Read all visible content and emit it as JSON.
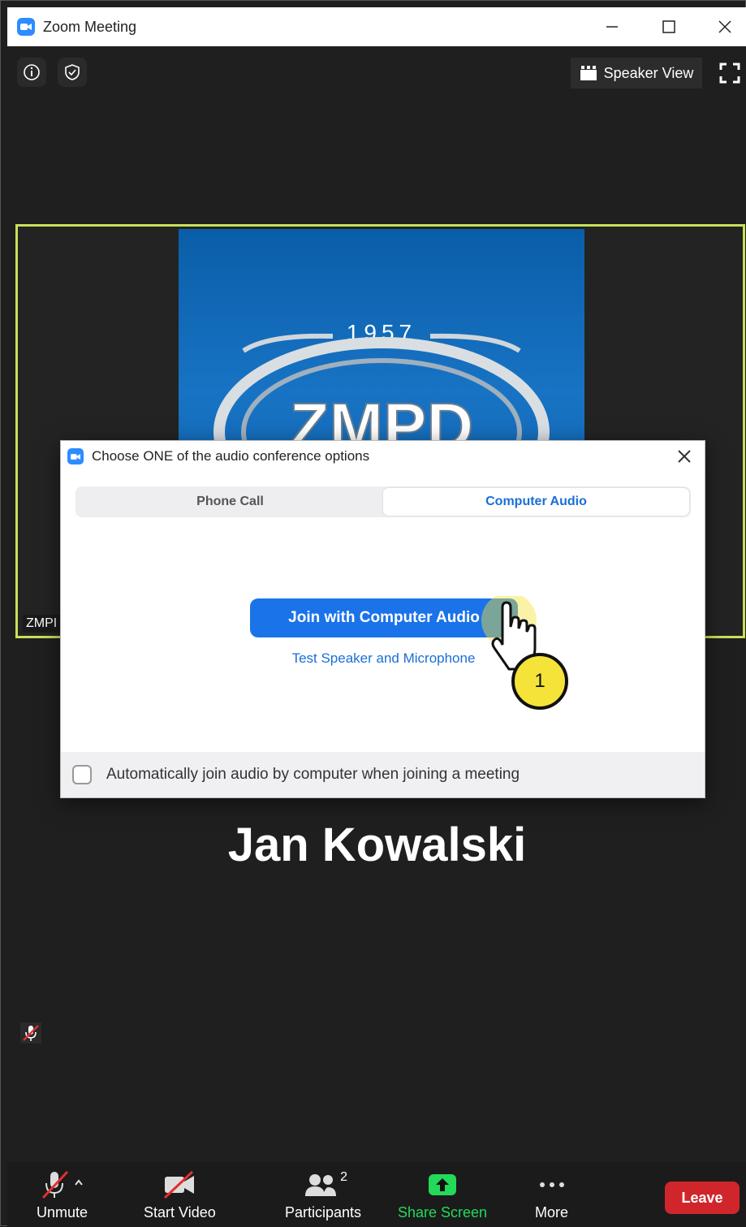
{
  "window": {
    "title": "Zoom Meeting",
    "controls": {
      "minimize": "—",
      "maximize": "□",
      "close": "✕"
    }
  },
  "top_bar": {
    "speaker_view_label": "Speaker View"
  },
  "video_tile": {
    "logo_year": "1957",
    "logo_text": "ZMPD",
    "name_label": "ZMPI"
  },
  "participant": {
    "name": "Jan Kowalski"
  },
  "audio_dialog": {
    "title": "Choose ONE of the audio conference options",
    "tabs": [
      {
        "label": "Phone Call",
        "active": false
      },
      {
        "label": "Computer Audio",
        "active": true
      }
    ],
    "join_button": "Join with Computer Audio",
    "test_link": "Test Speaker and Microphone",
    "auto_join_label": "Automatically join audio by computer when joining a meeting",
    "auto_join_checked": false
  },
  "step_badge": "1",
  "toolbar": {
    "unmute": "Unmute",
    "start_video": "Start Video",
    "participants": "Participants",
    "participants_count": "2",
    "share_screen": "Share Screen",
    "more": "More",
    "leave": "Leave"
  },
  "colors": {
    "accent_blue": "#1a73e8",
    "share_green": "#23d959",
    "leave_red": "#d0262b",
    "active_speaker_border": "#c8e05a",
    "step_yellow": "#f5e33a"
  }
}
